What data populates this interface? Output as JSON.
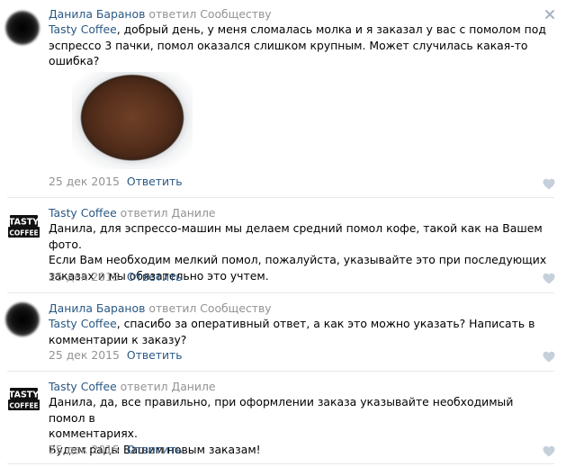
{
  "comments": [
    {
      "author": "Данила Баранов",
      "reply_to": "ответил Сообществу",
      "mention": "",
      "text_lines": [
        "Tasty Coffee, добрый день, у меня сломалась молка и я заказал у вас с помолом под",
        "эспрессо 3 пачки, помол оказался слишком крупным. Может случилась какая-то ошибка?"
      ],
      "date": "25 дек 2015",
      "reply_label": "Ответить"
    },
    {
      "author": "Tasty Coffee",
      "reply_to": "ответил Даниле",
      "text_lines": [
        "Данила, для эспрессо-машин мы делаем средний помол кофе, такой как на Вашем фото.",
        "Если Вам необходим мелкий помол, пожалуйста, указывайте это при последующих",
        "заказах и мы обязательно это учтем."
      ],
      "date": "25 дек 2015",
      "reply_label": "Ответить"
    },
    {
      "author": "Данила Баранов",
      "reply_to": "ответил Сообществу",
      "text_lines": [
        "Tasty Coffee, спасибо за оперативный ответ, а как это можно указать? Написать в",
        "комментарии к заказу?"
      ],
      "date": "25 дек 2015",
      "reply_label": "Ответить"
    },
    {
      "author": "Tasty Coffee",
      "reply_to": "ответил Даниле",
      "text_lines": [
        "Данила, да, все правильно, при оформлении заказа указывайте необходимый помол в",
        "комментариях.",
        "Будем рады Вашим новым заказам!"
      ],
      "date": "25 дек 2015",
      "reply_label": "Ответить"
    }
  ],
  "logo_text": "TASTY COFFEE",
  "colors": {
    "link": "#2a5885",
    "muted": "#939393",
    "divider": "#e7e8ec",
    "icon": "#c5d0db"
  }
}
